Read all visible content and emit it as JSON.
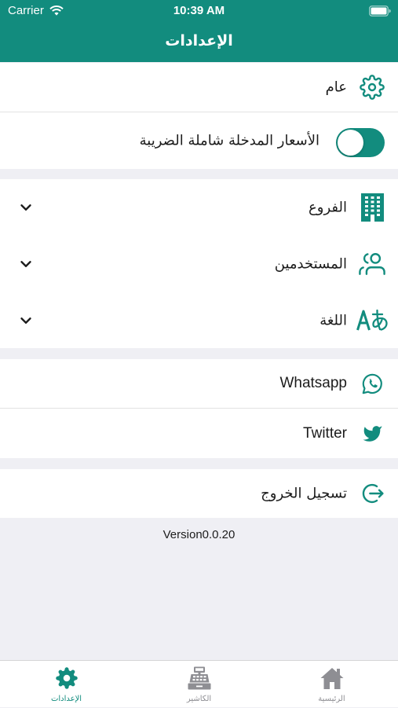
{
  "status_bar": {
    "carrier": "Carrier",
    "time": "10:39 AM"
  },
  "header": {
    "title": "الإعدادات"
  },
  "general_section": {
    "general": {
      "label": "عام",
      "icon": "gear-icon"
    },
    "tax_inclusive": {
      "label": "الأسعار المدخلة شاملة الضريبة",
      "enabled": true
    }
  },
  "management_section": {
    "branches": {
      "label": "الفروع",
      "icon": "building-icon",
      "expanded": false
    },
    "users": {
      "label": "المستخدمين",
      "icon": "users-icon",
      "expanded": false
    },
    "language": {
      "label": "اللغة",
      "icon": "translate-icon",
      "expanded": false
    }
  },
  "social_section": {
    "whatsapp": {
      "label": "Whatsapp",
      "icon": "whatsapp-icon"
    },
    "twitter": {
      "label": "Twitter",
      "icon": "twitter-icon"
    }
  },
  "account_section": {
    "logout": {
      "label": "تسجيل الخروج",
      "icon": "logout-icon"
    }
  },
  "version": "Version0.0.20",
  "tab_bar": {
    "tabs": [
      {
        "label": "الإعدادات",
        "icon": "gear-icon",
        "active": true
      },
      {
        "label": "الكاشير",
        "icon": "cash-register-icon",
        "active": false
      },
      {
        "label": "الرئيسية",
        "icon": "home-icon",
        "active": false
      }
    ]
  },
  "colors": {
    "accent": "#128c7e",
    "background": "#efeff4",
    "tab_inactive": "#8e8e93"
  }
}
